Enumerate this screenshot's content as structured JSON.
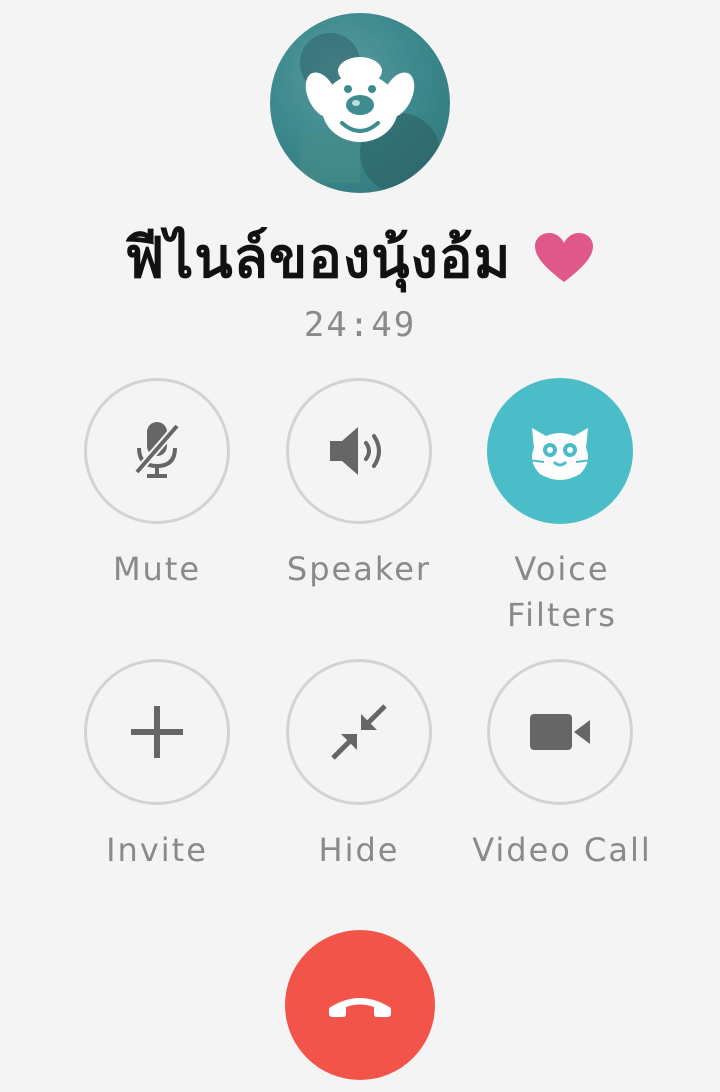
{
  "call": {
    "contact_name": "ฟีไนล์ของนุ้งอ้ม",
    "timer": "24:49"
  },
  "controls": {
    "mute": {
      "label": "Mute",
      "icon": "muted-microphone-icon"
    },
    "speaker": {
      "label": "Speaker",
      "icon": "speaker-icon"
    },
    "voice_filters": {
      "label_line1": "Voice",
      "label_line2": "Filters",
      "icon": "cat-face-icon",
      "active": true
    },
    "invite": {
      "label": "Invite",
      "icon": "plus-icon"
    },
    "hide": {
      "label": "Hide",
      "icon": "minimize-arrows-icon"
    },
    "video_call": {
      "label": "Video Call",
      "icon": "video-camera-icon"
    }
  },
  "end_call": {
    "icon": "hang-up-phone-icon"
  },
  "colors": {
    "background": "#f4f4f4",
    "accent": "#4bbdc9",
    "end_call": "#f25449",
    "heart": "#e0588a",
    "label": "#8a8a8a"
  }
}
